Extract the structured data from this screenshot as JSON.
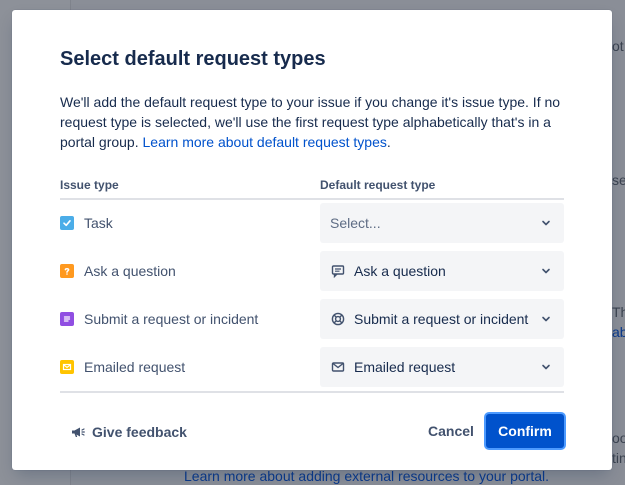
{
  "background": {
    "fragments_right": [
      "ot",
      "se",
      "Th",
      "ab",
      "oo",
      "tin"
    ],
    "bottom_link": "Learn more about adding external resources to your portal."
  },
  "modal": {
    "title": "Select default request types",
    "description": {
      "text": "We'll add the default request type to your issue if you change it's issue type. If no request type is selected, we'll use the first request type alphabetically that's in a portal group.",
      "link": "Learn more about default request types",
      "trailing": "."
    },
    "table": {
      "headers": {
        "issue_type": "Issue type",
        "default_request_type": "Default request type"
      },
      "rows": [
        {
          "issue": "Task",
          "issue_icon": "task-icon",
          "issue_color": "#4bade8",
          "request": "Select...",
          "request_icon": "",
          "placeholder": true
        },
        {
          "issue": "Ask a question",
          "issue_icon": "question-icon",
          "issue_color": "#ff991f",
          "request": "Ask a question",
          "request_icon": "chat-icon",
          "placeholder": false
        },
        {
          "issue": "Submit a request or incident",
          "issue_icon": "request-icon",
          "issue_color": "#904ee2",
          "request": "Submit a request or incident",
          "request_icon": "lifebuoy-icon",
          "placeholder": false
        },
        {
          "issue": "Emailed request",
          "issue_icon": "email-icon",
          "issue_color": "#ffc400",
          "request": "Emailed request",
          "request_icon": "envelope-icon",
          "placeholder": false
        }
      ]
    },
    "footer": {
      "feedback_label": "Give feedback",
      "cancel_label": "Cancel",
      "confirm_label": "Confirm"
    }
  },
  "colors": {
    "primary": "#0052cc",
    "link": "#0052cc",
    "text": "#172b4d",
    "subtle_text": "#42526e",
    "field_bg": "#f4f5f7",
    "overlay": "#8a8e97"
  }
}
